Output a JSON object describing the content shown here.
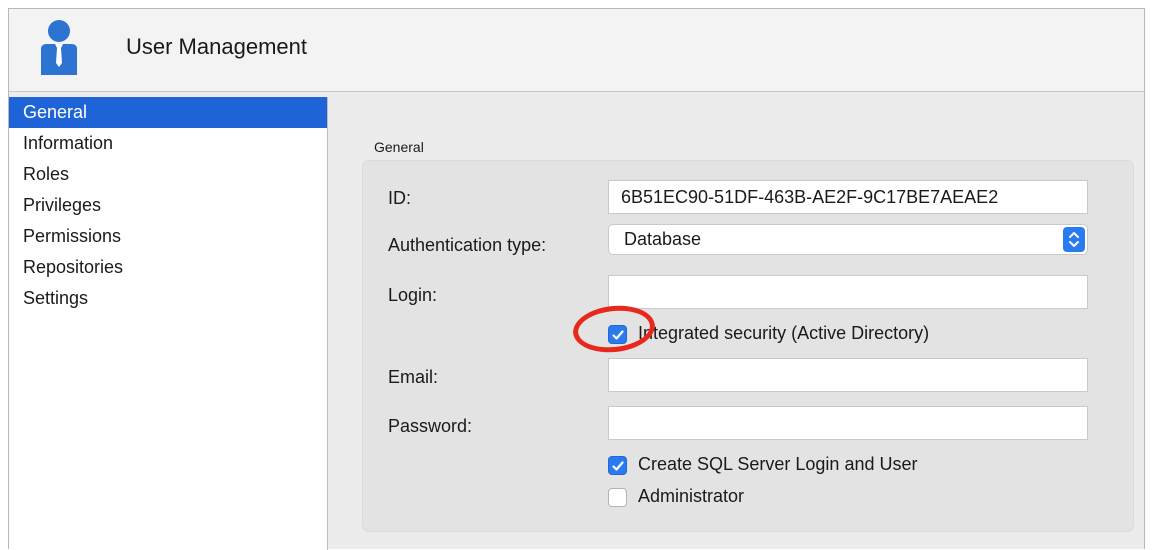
{
  "header": {
    "title": "User Management",
    "icon": "user-icon"
  },
  "sidebar": {
    "items": [
      {
        "label": "General",
        "selected": true
      },
      {
        "label": "Information"
      },
      {
        "label": "Roles"
      },
      {
        "label": "Privileges"
      },
      {
        "label": "Permissions"
      },
      {
        "label": "Repositories"
      },
      {
        "label": "Settings"
      }
    ]
  },
  "main": {
    "group_title": "General",
    "form": {
      "id_label": "ID:",
      "id_value": "6B51EC90-51DF-463B-AE2F-9C17BE7AEAE2",
      "auth_label": "Authentication type:",
      "auth_value": "Database",
      "login_label": "Login:",
      "login_value": "",
      "integrated_label": "Integrated security (Active Directory)",
      "integrated_checked": true,
      "email_label": "Email:",
      "email_value": "",
      "password_label": "Password:",
      "password_value": "",
      "create_login_label": "Create SQL Server Login and User",
      "create_login_checked": true,
      "admin_label": "Administrator",
      "admin_checked": false
    }
  },
  "colors": {
    "accent": "#2b7bf0",
    "selection": "#1f64d6",
    "annotation": "#e8281c"
  }
}
